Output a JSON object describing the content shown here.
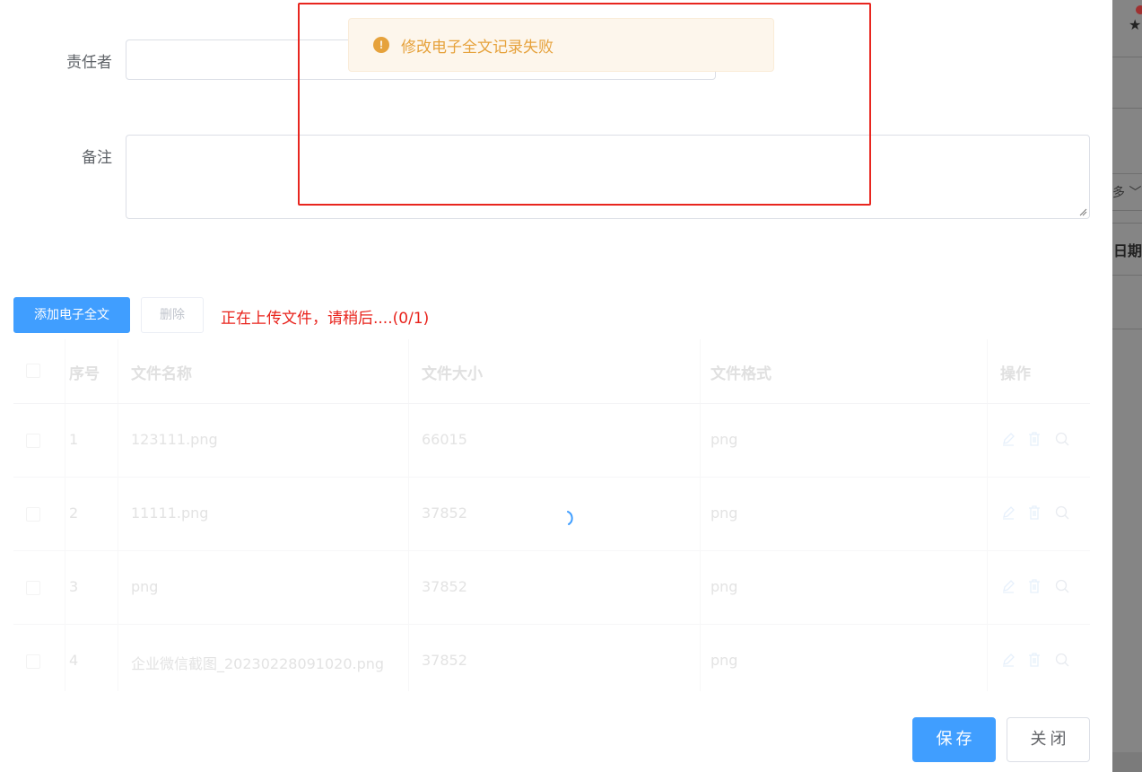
{
  "form": {
    "responsible_label": "责任者",
    "responsible_value": "",
    "remark_label": "备注",
    "remark_value": ""
  },
  "toolbar": {
    "add_label": "添加电子全文",
    "delete_label": "删除",
    "upload_status": "正在上传文件，请稍后....(0/1)"
  },
  "table": {
    "headers": [
      "序号",
      "文件名称",
      "文件大小",
      "文件格式",
      "操作"
    ],
    "rows": [
      {
        "index": "1",
        "name": "123111.png",
        "size": "66015",
        "format": "png"
      },
      {
        "index": "2",
        "name": "11111.png",
        "size": "37852",
        "format": "png"
      },
      {
        "index": "3",
        "name": "png",
        "size": "37852",
        "format": "png"
      },
      {
        "index": "4",
        "name": "企业微信截图_20230228091020.png",
        "size": "37852",
        "format": "png"
      }
    ]
  },
  "footer": {
    "save_label": "保存",
    "close_label": "关闭"
  },
  "toast": {
    "type": "warning",
    "message": "修改电子全文记录失败",
    "icon": "!"
  },
  "backdrop": {
    "partial_dropdown": "多",
    "partial_header": "日期"
  },
  "colors": {
    "primary": "#409eff",
    "warning": "#e6a23c",
    "status_red": "#e8221b",
    "annotation_red": "#e8261f"
  }
}
